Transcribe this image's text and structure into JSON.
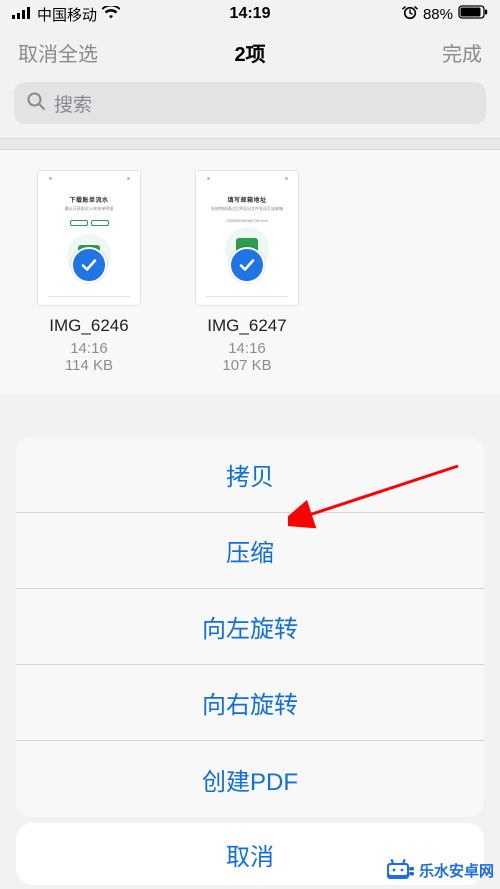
{
  "status": {
    "signal_label": "signal-icon",
    "carrier": "中国移动",
    "wifi_label": "wifi-icon",
    "time": "14:19",
    "alarm_label": "alarm-icon",
    "battery_pct": "88%",
    "battery_label": "battery-icon"
  },
  "nav": {
    "left": "取消全选",
    "title": "2项",
    "right": "完成"
  },
  "search": {
    "placeholder": "搜索"
  },
  "files": [
    {
      "name": "IMG_6246",
      "time": "14:16",
      "size": "114 KB",
      "selected": true
    },
    {
      "name": "IMG_6247",
      "time": "14:16",
      "size": "107 KB",
      "selected": true
    }
  ],
  "action_sheet": {
    "items": [
      {
        "id": "copy",
        "label": "拷贝"
      },
      {
        "id": "compress",
        "label": "压缩"
      },
      {
        "id": "rotate-left",
        "label": "向左旋转"
      },
      {
        "id": "rotate-right",
        "label": "向右旋转"
      },
      {
        "id": "create-pdf",
        "label": "创建PDF"
      }
    ],
    "cancel": "取消"
  },
  "annotation": {
    "arrow_target": "compress"
  },
  "watermark": {
    "text": "乐水安卓网"
  },
  "colors": {
    "ios_blue": "#0f6fe0",
    "selection_blue": "#1f74e6",
    "arrow_red": "#ff0000",
    "gray_text": "#8d8d91"
  }
}
